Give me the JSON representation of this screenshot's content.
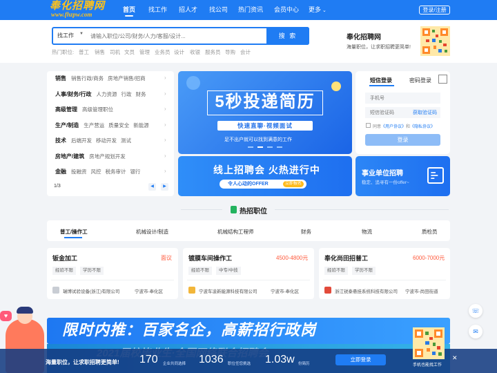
{
  "header": {
    "logo": "奉化招聘网",
    "logo_url": "www.fhzpw.com",
    "nav": [
      "首页",
      "找工作",
      "招人才",
      "找公司",
      "热门资讯",
      "会员中心",
      "更多"
    ],
    "login": "登录/注册"
  },
  "search": {
    "type": "找工作",
    "placeholder": "请输入职位/公司/财务/人力/客服/设计...",
    "button": "搜 索",
    "hot_label": "热门职位:",
    "hot": [
      "普工",
      "销售",
      "司机",
      "文员",
      "管理",
      "业务员",
      "设计",
      "收银",
      "服务员",
      "导购",
      "会计"
    ]
  },
  "brand": {
    "title": "奉化招聘网",
    "subtitle": "海量职位，让求职招聘更简单!"
  },
  "categories": [
    {
      "main": "销售",
      "subs": [
        "销售行政/商务",
        "房地产销售/招商"
      ]
    },
    {
      "main": "人事/财务/行政",
      "subs": [
        "人力资源",
        "行政",
        "财务"
      ]
    },
    {
      "main": "高级管理",
      "subs": [
        "高级管理职位"
      ]
    },
    {
      "main": "生产/制造",
      "subs": [
        "生产营运",
        "质量安全",
        "新能源"
      ]
    },
    {
      "main": "技术",
      "subs": [
        "后端开发",
        "移动开发",
        "测试"
      ]
    },
    {
      "main": "房地产/建筑",
      "subs": [
        "房地产规划开发"
      ]
    },
    {
      "main": "金融",
      "subs": [
        "投融资",
        "风控",
        "税务审计",
        "银行"
      ]
    }
  ],
  "cat_page": "1/3",
  "banner1": {
    "title": "5秒投递简历",
    "tag": "快速直聊·视频面试",
    "sub": "足不出户就可以找到满意的工作"
  },
  "banner2": {
    "title": "线上招聘会 火热进行中",
    "pill": "令人心动的OFFER",
    "go": "立即报名"
  },
  "login_card": {
    "tab_sms": "短信登录",
    "tab_pwd": "密码登录",
    "phone_ph": "手机号",
    "code_ph": "短信验证码",
    "get_code": "获取验证码",
    "agree_pre": "同意",
    "agree_user": "《用户协议》",
    "agree_and": "和",
    "agree_privacy": "《隐私协议》",
    "submit": "登录"
  },
  "unit_card": {
    "title": "事业单位招聘",
    "sub": "稳定、追寻有一份offer~"
  },
  "hot_jobs": {
    "title": "热招职位",
    "tabs": [
      "普工/操作工",
      "机械设计/制造",
      "机械结构工程师",
      "财务",
      "物流",
      "质检员"
    ],
    "jobs": [
      {
        "title": "钣金加工",
        "salary": "面议",
        "tags": [
          "经验不限",
          "学历不限"
        ],
        "company": "瑞博试验设备(浙江)有限公司",
        "loc": "宁波市-奉化区"
      },
      {
        "title": "镀膜车间操作工",
        "salary": "4500-4800元",
        "tags": [
          "经验不限",
          "中专/中技"
        ],
        "company": "宁波车凌新能源科技有限公司",
        "loc": "宁波市-奉化区"
      },
      {
        "title": "奉化尚田招普工",
        "salary": "6000-7000元",
        "tags": [
          "经验不限",
          "学历不限"
        ],
        "company": "浙江锐泰悬挂系统科技有限公司",
        "loc": "宁波市-尚田街道"
      }
    ]
  },
  "promo": {
    "title": "限时内推：百家名企，高薪招行政岗",
    "title2": "2021届校毕业生·全国网络联合招聘会"
  },
  "bottom_bar": {
    "text": "海量职位，让求职招聘更简单!",
    "stats": [
      {
        "num": "170",
        "label": "企业共同选择"
      },
      {
        "num": "1036",
        "label": "职位任您挑选"
      },
      {
        "num": "1.03w",
        "label": "份简历"
      }
    ],
    "button": "立即登录",
    "qr_label": "手机也能找工作",
    "close": "✕"
  },
  "colors": {
    "primary": "#1f7cf3",
    "logo": "#ffc21a",
    "salary": "#ff5a3c"
  }
}
